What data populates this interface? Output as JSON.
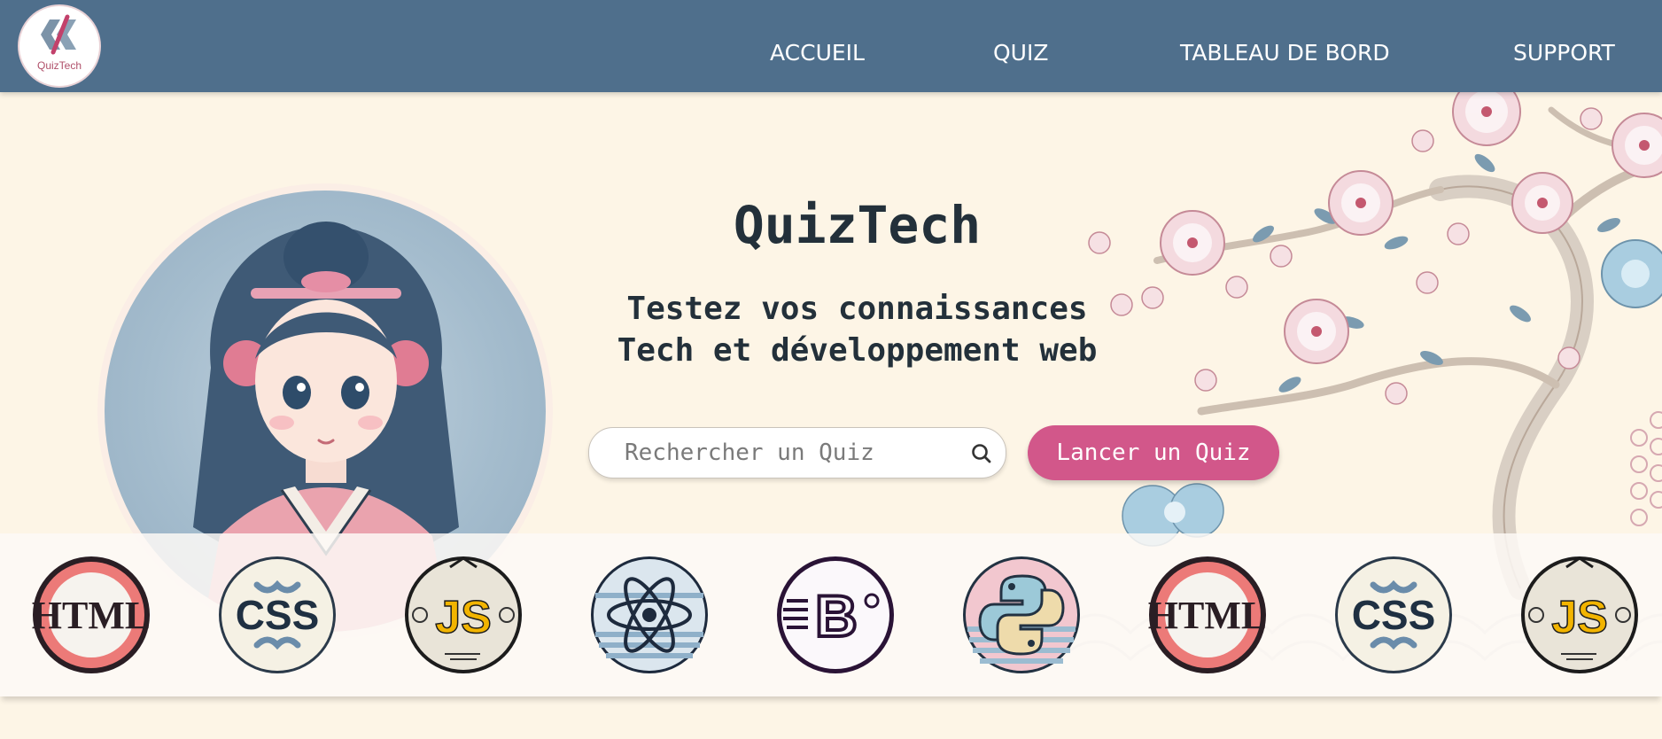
{
  "brand": {
    "logo_caption": "QuizTech"
  },
  "nav": {
    "items": [
      {
        "label": "ACCUEIL"
      },
      {
        "label": "QUIZ"
      },
      {
        "label": "TABLEAU DE BORD"
      },
      {
        "label": "SUPPORT"
      }
    ]
  },
  "hero": {
    "title": "QuizTech",
    "subtitle_line1": "Testez vos connaissances",
    "subtitle_line2": "Tech et développement web",
    "search_placeholder": "Rechercher un Quiz",
    "search_icon": "search-icon",
    "cta_label": "Lancer un Quiz"
  },
  "carousel": {
    "badges": [
      {
        "text": "HTML",
        "icon": "html-badge"
      },
      {
        "text": "CSS",
        "icon": "css-badge"
      },
      {
        "text": "JS",
        "icon": "js-badge"
      },
      {
        "text": "",
        "icon": "react-atom-badge"
      },
      {
        "text": "B",
        "icon": "bootstrap-badge"
      },
      {
        "text": "",
        "icon": "python-badge"
      },
      {
        "text": "HTML",
        "icon": "html-badge"
      },
      {
        "text": "CSS",
        "icon": "css-badge"
      },
      {
        "text": "JS",
        "icon": "js-badge"
      }
    ]
  },
  "colors": {
    "navbar": "#4f6f8c",
    "background": "#fdf5e6",
    "accent_pink": "#d2578a",
    "title_text": "#23303a"
  }
}
